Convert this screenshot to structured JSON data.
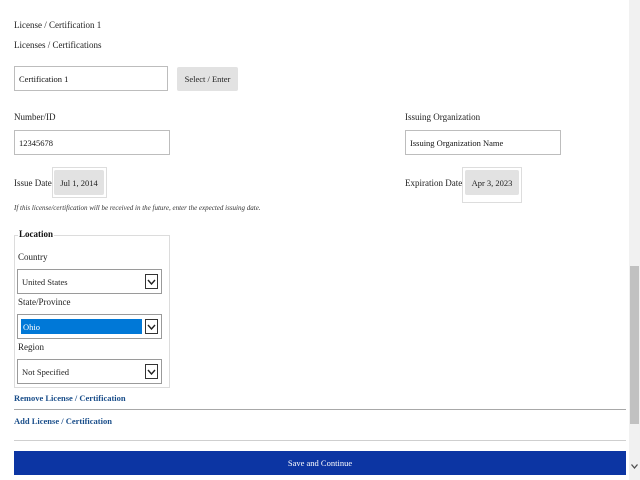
{
  "section": {
    "title": "License / Certification 1",
    "field_label": "Licenses / Certifications",
    "name_value": "Certification 1",
    "select_button": "Select / Enter"
  },
  "number": {
    "label": "Number/ID",
    "value": "12345678"
  },
  "issuer": {
    "label": "Issuing Organization",
    "value": "Issuing Organization Name"
  },
  "issue_date": {
    "label": "Issue Date",
    "value": "Jul 1, 2014"
  },
  "expiration_date": {
    "label": "Expiration Date",
    "value": "Apr 3, 2023"
  },
  "hint": "If this license/certification will be received in the future, enter the expected issuing date.",
  "location": {
    "legend": "Location",
    "country": {
      "label": "Country",
      "value": "United States"
    },
    "state": {
      "label": "State/Province",
      "value": "Ohio"
    },
    "region": {
      "label": "Region",
      "value": "Not Specified"
    }
  },
  "links": {
    "remove": "Remove License / Certification",
    "add": "Add License / Certification"
  },
  "submit_label": "Save and Continue",
  "colors": {
    "primary": "#0c35a3",
    "link": "#1a4e8a",
    "selection": "#0078d7"
  }
}
